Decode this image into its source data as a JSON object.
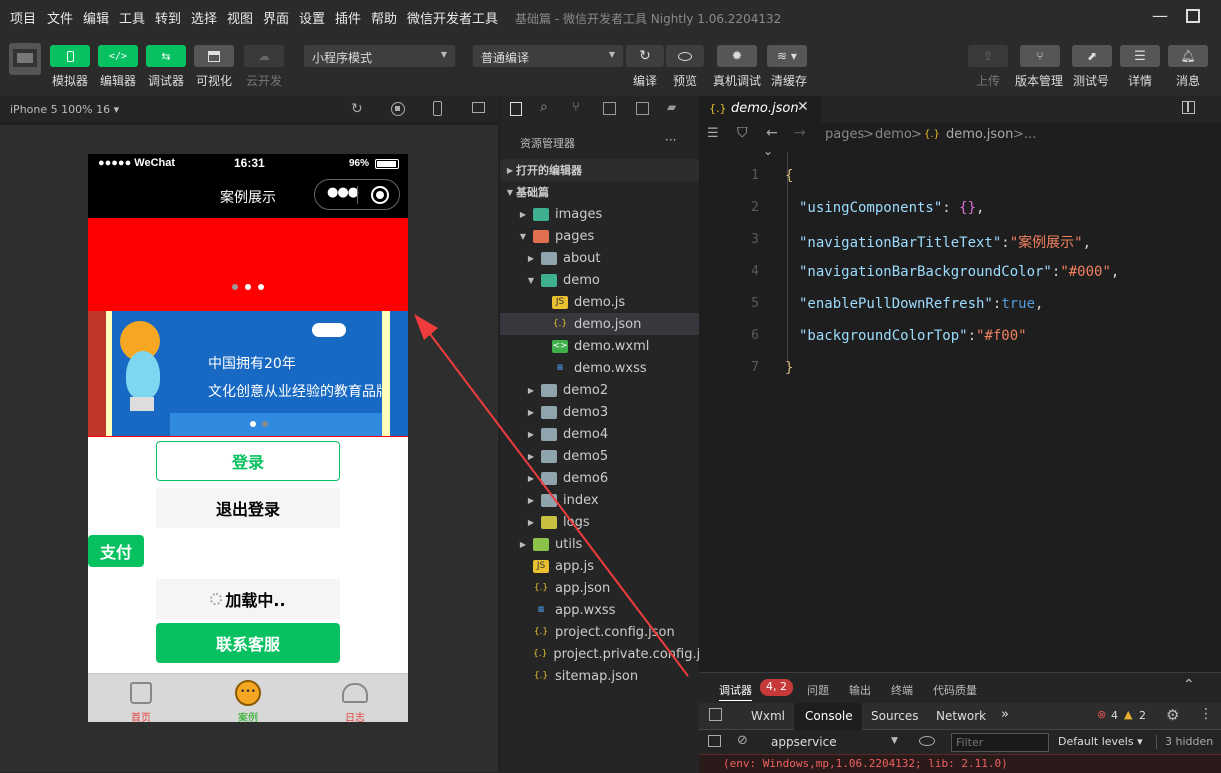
{
  "menubar": {
    "items": [
      "项目",
      "文件",
      "编辑",
      "工具",
      "转到",
      "选择",
      "视图",
      "界面",
      "设置",
      "插件",
      "帮助",
      "微信开发者工具"
    ],
    "window_title": "基础篇 - 微信开发者工具 Nightly 1.06.2204132"
  },
  "toolbar": {
    "left_buttons": [
      {
        "label": "模拟器",
        "icon": "phone-icon"
      },
      {
        "label": "编辑器",
        "icon": "code-icon"
      },
      {
        "label": "调试器",
        "icon": "debug-icon"
      },
      {
        "label": "可视化",
        "icon": "layout-icon"
      },
      {
        "label": "云开发",
        "icon": "cloud-icon"
      }
    ],
    "mode_select": "小程序模式",
    "compile_select": "普通编译",
    "mid_buttons": [
      {
        "label": "编译",
        "icon": "refresh-icon"
      },
      {
        "label": "预览",
        "icon": "eye-icon"
      },
      {
        "label": "真机调试",
        "icon": "bug-icon"
      },
      {
        "label": "清缓存",
        "icon": "layers-icon"
      }
    ],
    "right_buttons": [
      {
        "label": "上传",
        "icon": "upload-icon"
      },
      {
        "label": "版本管理",
        "icon": "branch-icon"
      },
      {
        "label": "测试号",
        "icon": "external-icon"
      },
      {
        "label": "详情",
        "icon": "menu-icon"
      },
      {
        "label": "消息",
        "icon": "bell-icon"
      }
    ]
  },
  "simulator": {
    "device": "iPhone 5 100% 16",
    "status": {
      "carrier": "●●●●● WeChat",
      "time": "16:31",
      "battery": "96%"
    },
    "nav_title": "案例展示",
    "swiper_text_1": "中国拥有20年",
    "swiper_text_2": "文化创意从业经验的教育品牌",
    "buttons": {
      "login": "登录",
      "logout": "退出登录",
      "pay": "支付",
      "loading": "加载中..",
      "contact": "联系客服"
    },
    "tabs": [
      "首页",
      "案例",
      "日志"
    ]
  },
  "explorer": {
    "title": "资源管理器",
    "more": "···",
    "sections": {
      "open_editors": "打开的编辑器",
      "project": "基础篇"
    },
    "tree": [
      "images",
      "pages",
      "about",
      "demo",
      "demo.js",
      "demo.json",
      "demo.wxml",
      "demo.wxss",
      "demo2",
      "demo3",
      "demo4",
      "demo5",
      "demo6",
      "index",
      "logs",
      "utils",
      "app.js",
      "app.json",
      "app.wxss",
      "project.config.json",
      "project.private.config.js...",
      "sitemap.json"
    ]
  },
  "editor": {
    "tab": "demo.json",
    "breadcrumb": [
      "pages",
      ">",
      "demo",
      ">",
      "demo.json",
      ">",
      "..."
    ],
    "lines": [
      "1",
      "2",
      "3",
      "4",
      "5",
      "6",
      "7"
    ],
    "tokens": {
      "open": "{",
      "close": "}",
      "k1": "\"usingComponents\"",
      "v1": "{}",
      "k2": "\"navigationBarTitleText\"",
      "v2": "\"案例展示\"",
      "k3": "\"navigationBarBackgroundColor\"",
      "v3": "\"#000\"",
      "k4": "\"enablePullDownRefresh\"",
      "v4": "true",
      "k5": "\"backgroundColorTop\"",
      "v5": "\"#f00\"",
      "colon": ":",
      "colon_sp": ": ",
      "comma": ","
    }
  },
  "debug": {
    "tabs": [
      "调试器",
      "问题",
      "输出",
      "终端",
      "代码质量"
    ],
    "badge": "4, 2",
    "subtabs": [
      "Wxml",
      "Console",
      "Sources",
      "Network"
    ],
    "more": "»",
    "errors": "4",
    "warnings": "2",
    "context": "appservice",
    "filter_placeholder": "Filter",
    "levels": "Default levels",
    "hidden": "3 hidden",
    "log": "(env: Windows,mp,1.06.2204132; lib: 2.11.0)"
  },
  "colors": {
    "accent": "#07c160",
    "nav_bg": "#000000",
    "banner": "#ff0000",
    "annotation_arrow": "#f03c3c"
  }
}
